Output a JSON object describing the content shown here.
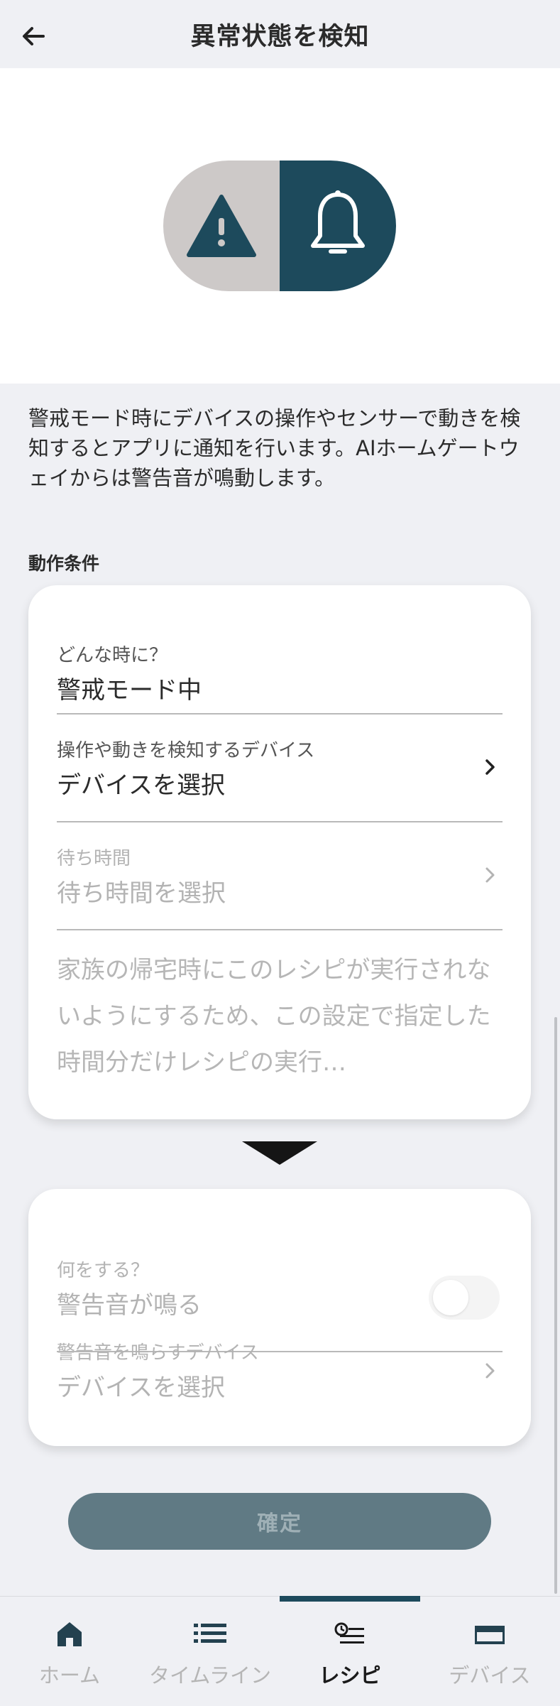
{
  "header": {
    "title": "異常状態を検知"
  },
  "description": "警戒モード時にデバイスの操作やセンサーで動きを検知するとアプリに通知を行います。AIホームゲートウェイからは警告音が鳴動します。",
  "section_label": "動作条件",
  "condition_card": {
    "when": {
      "label": "どんな時に？",
      "value": "警戒モード中"
    },
    "device": {
      "label": "操作や動きを検知するデバイス",
      "value": "デバイスを選択"
    },
    "wait": {
      "label": "待ち時間",
      "value": "待ち時間を選択"
    },
    "note": "家族の帰宅時にこのレシピが実行されないようにするため、この設定で指定した時間分だけレシピの実行…"
  },
  "action_card": {
    "what": {
      "label": "何をする？",
      "value": "警告音が鳴る",
      "toggle_on": false
    },
    "device": {
      "label": "警告音を鳴らすデバイス",
      "value": "デバイスを選択"
    }
  },
  "confirm_label": "確定",
  "nav": {
    "items": [
      {
        "label": "ホーム",
        "icon": "home-icon",
        "active": false
      },
      {
        "label": "タイムライン",
        "icon": "list-icon",
        "active": false
      },
      {
        "label": "レシピ",
        "icon": "recipe-icon",
        "active": true
      },
      {
        "label": "デバイス",
        "icon": "device-icon",
        "active": false
      }
    ]
  },
  "colors": {
    "accent": "#1d4a5c",
    "background": "#eff0f4",
    "confirm_button": "#607a84",
    "warning_panel": "#cdc9c8"
  }
}
